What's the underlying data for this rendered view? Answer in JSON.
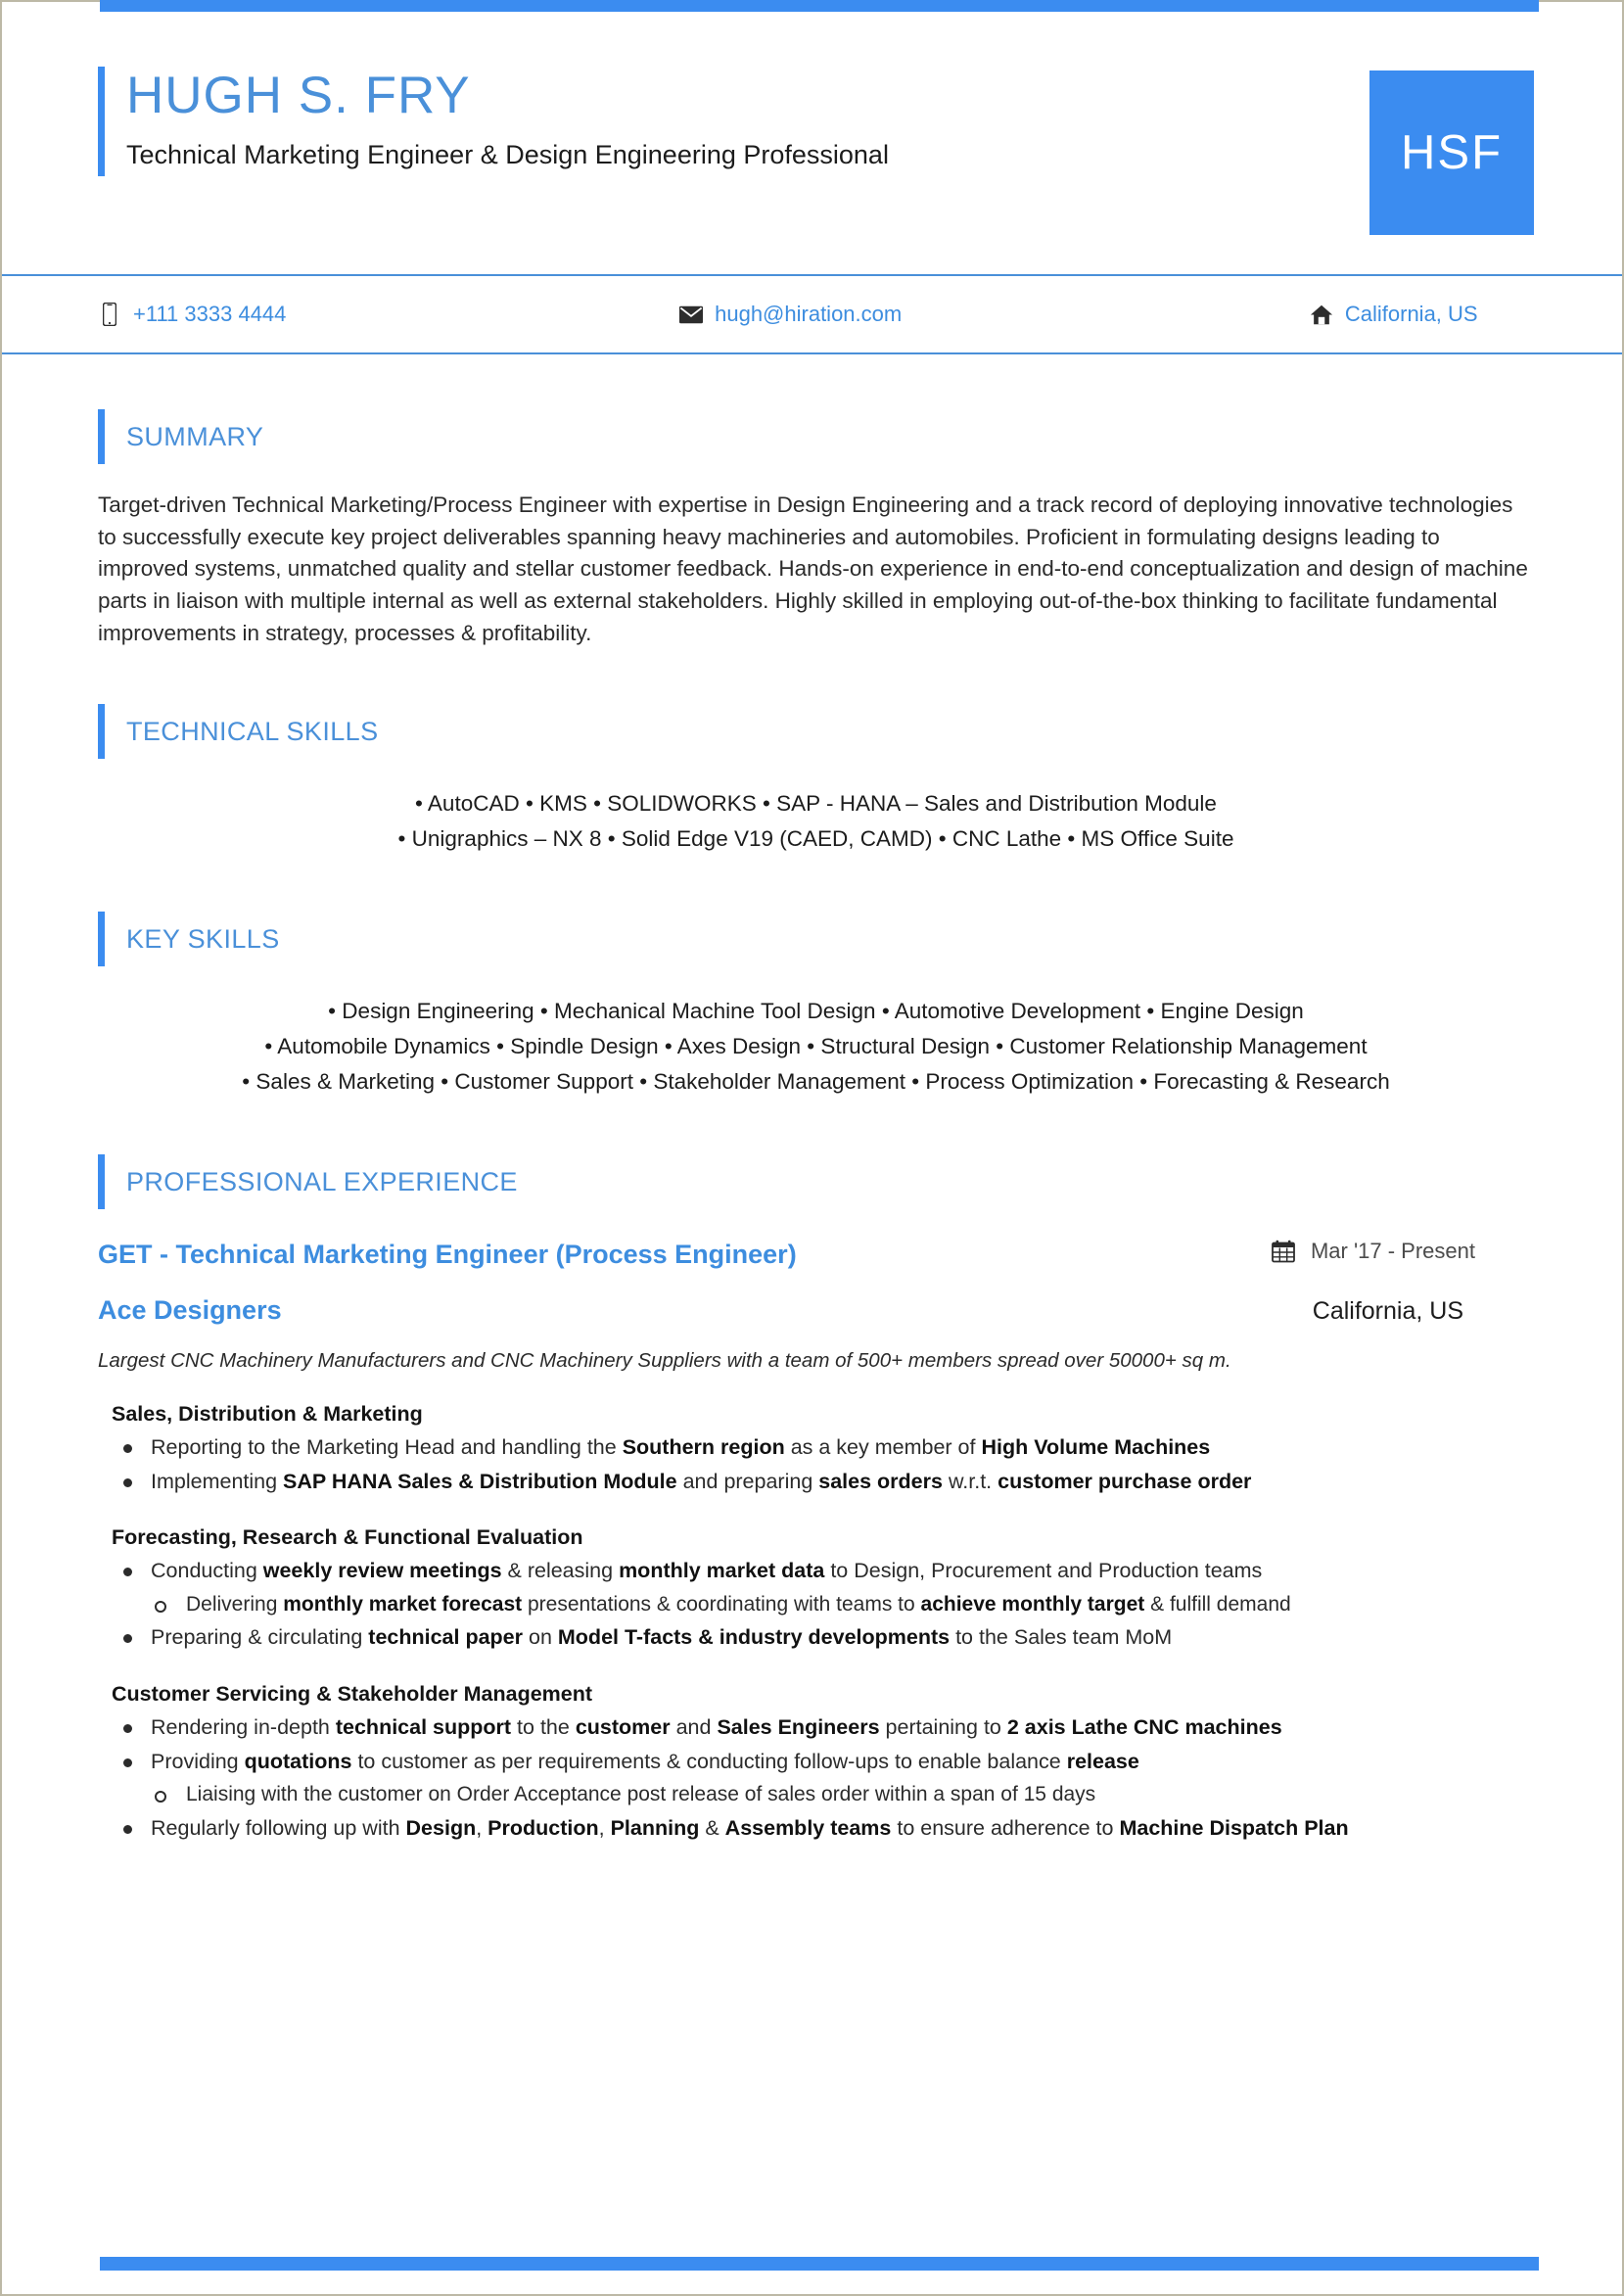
{
  "theme": {
    "accent": "#3b8cf0",
    "accent_text": "#4a90d9",
    "body_text": "#2b2b2b"
  },
  "header": {
    "name": "HUGH S. FRY",
    "title": "Technical Marketing Engineer & Design Engineering Professional",
    "monogram": "HSF"
  },
  "contact": {
    "phone": "+111 3333 4444",
    "email": "hugh@hiration.com",
    "location": "California, US"
  },
  "sections": {
    "summary": {
      "heading": "SUMMARY",
      "text": "Target-driven Technical Marketing/Process Engineer with expertise in Design Engineering and a track record of deploying innovative technologies to successfully execute key project deliverables spanning heavy machineries and automobiles. Proficient in formulating designs leading to improved systems, unmatched quality and stellar customer feedback. Hands-on experience in end-to-end conceptualization and design of machine parts in liaison with multiple internal as well as external stakeholders. Highly skilled in employing out-of-the-box thinking to facilitate fundamental improvements in strategy, processes & profitability."
    },
    "technical_skills": {
      "heading": "TECHNICAL SKILLS",
      "lines": [
        "• AutoCAD • KMS • SOLIDWORKS • SAP - HANA – Sales and Distribution Module",
        "• Unigraphics – NX 8 • Solid Edge V19 (CAED, CAMD) • CNC Lathe • MS Office Suite"
      ]
    },
    "key_skills": {
      "heading": "KEY SKILLS",
      "lines": [
        "• Design Engineering • Mechanical Machine Tool Design • Automotive Development • Engine Design",
        "• Automobile Dynamics • Spindle Design • Axes Design • Structural Design • Customer Relationship Management",
        "• Sales & Marketing • Customer Support • Stakeholder Management • Process Optimization • Forecasting & Research"
      ]
    },
    "experience": {
      "heading": "PROFESSIONAL EXPERIENCE",
      "entries": [
        {
          "role": "GET - Technical Marketing Engineer (Process Engineer)",
          "date": "Mar '17 -  Present",
          "company": "Ace Designers",
          "location": "California, US",
          "description": "Largest CNC Machinery Manufacturers and CNC Machinery Suppliers with a team of 500+ members spread over 50000+ sq m.",
          "groups": [
            {
              "title": "Sales, Distribution & Marketing",
              "bullets": [
                {
                  "level": 1,
                  "html": "Reporting to the Marketing Head and handling the <b>Southern region</b> as a key member of <b>High Volume Machines</b>"
                },
                {
                  "level": 1,
                  "html": "Implementing <b>SAP HANA Sales &amp; Distribution Module</b> and preparing <b>sales orders</b> w.r.t. <b>customer purchase order</b>"
                }
              ]
            },
            {
              "title": "Forecasting, Research & Functional Evaluation",
              "bullets": [
                {
                  "level": 1,
                  "html": "Conducting <b>weekly review meetings</b> &amp; releasing <b>monthly market data</b> to Design, Procurement and Production teams"
                },
                {
                  "level": 2,
                  "html": "Delivering <b>monthly market forecast</b> presentations &amp; coordinating with teams to <b>achieve monthly target</b> &amp; fulfill demand"
                },
                {
                  "level": 1,
                  "html": "Preparing &amp; circulating <b>technical paper</b> on <b>Model T-facts &amp; industry developments</b> to the Sales team MoM"
                }
              ]
            },
            {
              "title": "Customer Servicing & Stakeholder Management",
              "bullets": [
                {
                  "level": 1,
                  "html": "Rendering in-depth <b>technical support</b> to the <b>customer</b> and <b>Sales Engineers</b> pertaining to <b>2 axis Lathe CNC machines</b>"
                },
                {
                  "level": 1,
                  "html": "Providing <b>quotations</b> to customer as per requirements &amp; conducting follow-ups to enable balance <b>release</b>"
                },
                {
                  "level": 2,
                  "html": "Liaising with the customer on Order Acceptance post release of sales order within a span of 15 days"
                },
                {
                  "level": 1,
                  "html": "Regularly following up with <b>Design</b>, <b>Production</b>, <b>Planning</b> &amp; <b>Assembly teams</b> to ensure adherence to <b>Machine Dispatch Plan</b>"
                }
              ]
            }
          ]
        }
      ]
    }
  }
}
